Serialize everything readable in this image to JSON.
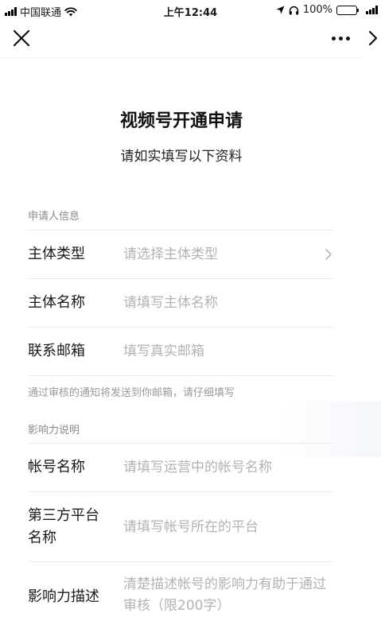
{
  "status_bar": {
    "carrier": "中国联通",
    "time": "上午12:44",
    "battery": "100%"
  },
  "nav": {
    "close_icon": "close-icon",
    "more_icon": "more-icon",
    "next_icon": "chevron-right-icon"
  },
  "title": "视频号开通申请",
  "subtitle": "请如实填写以下资料",
  "sections": {
    "applicant": {
      "label": "申请人信息",
      "rows": [
        {
          "label": "主体类型",
          "placeholder": "请选择主体类型"
        },
        {
          "label": "主体名称",
          "placeholder": "请填写主体名称"
        },
        {
          "label": "联系邮箱",
          "placeholder": "填写真实邮箱"
        }
      ],
      "hint": "通过审核的通知将发送到你邮箱，请仔细填写"
    },
    "influence": {
      "label": "影响力说明",
      "rows": [
        {
          "label": "帐号名称",
          "placeholder": "请填写运营中的帐号名称"
        },
        {
          "label": "第三方平台名称",
          "placeholder": "请填写帐号所在的平台"
        },
        {
          "label": "影响力描述",
          "placeholder": "清楚描述帐号的影响力有助于通过审核（限200字）"
        }
      ]
    }
  },
  "colors": {
    "text": "#1a1a1a",
    "placeholder": "#b3b3b3",
    "section_label": "#8a8a8a",
    "divider": "#ececec"
  }
}
